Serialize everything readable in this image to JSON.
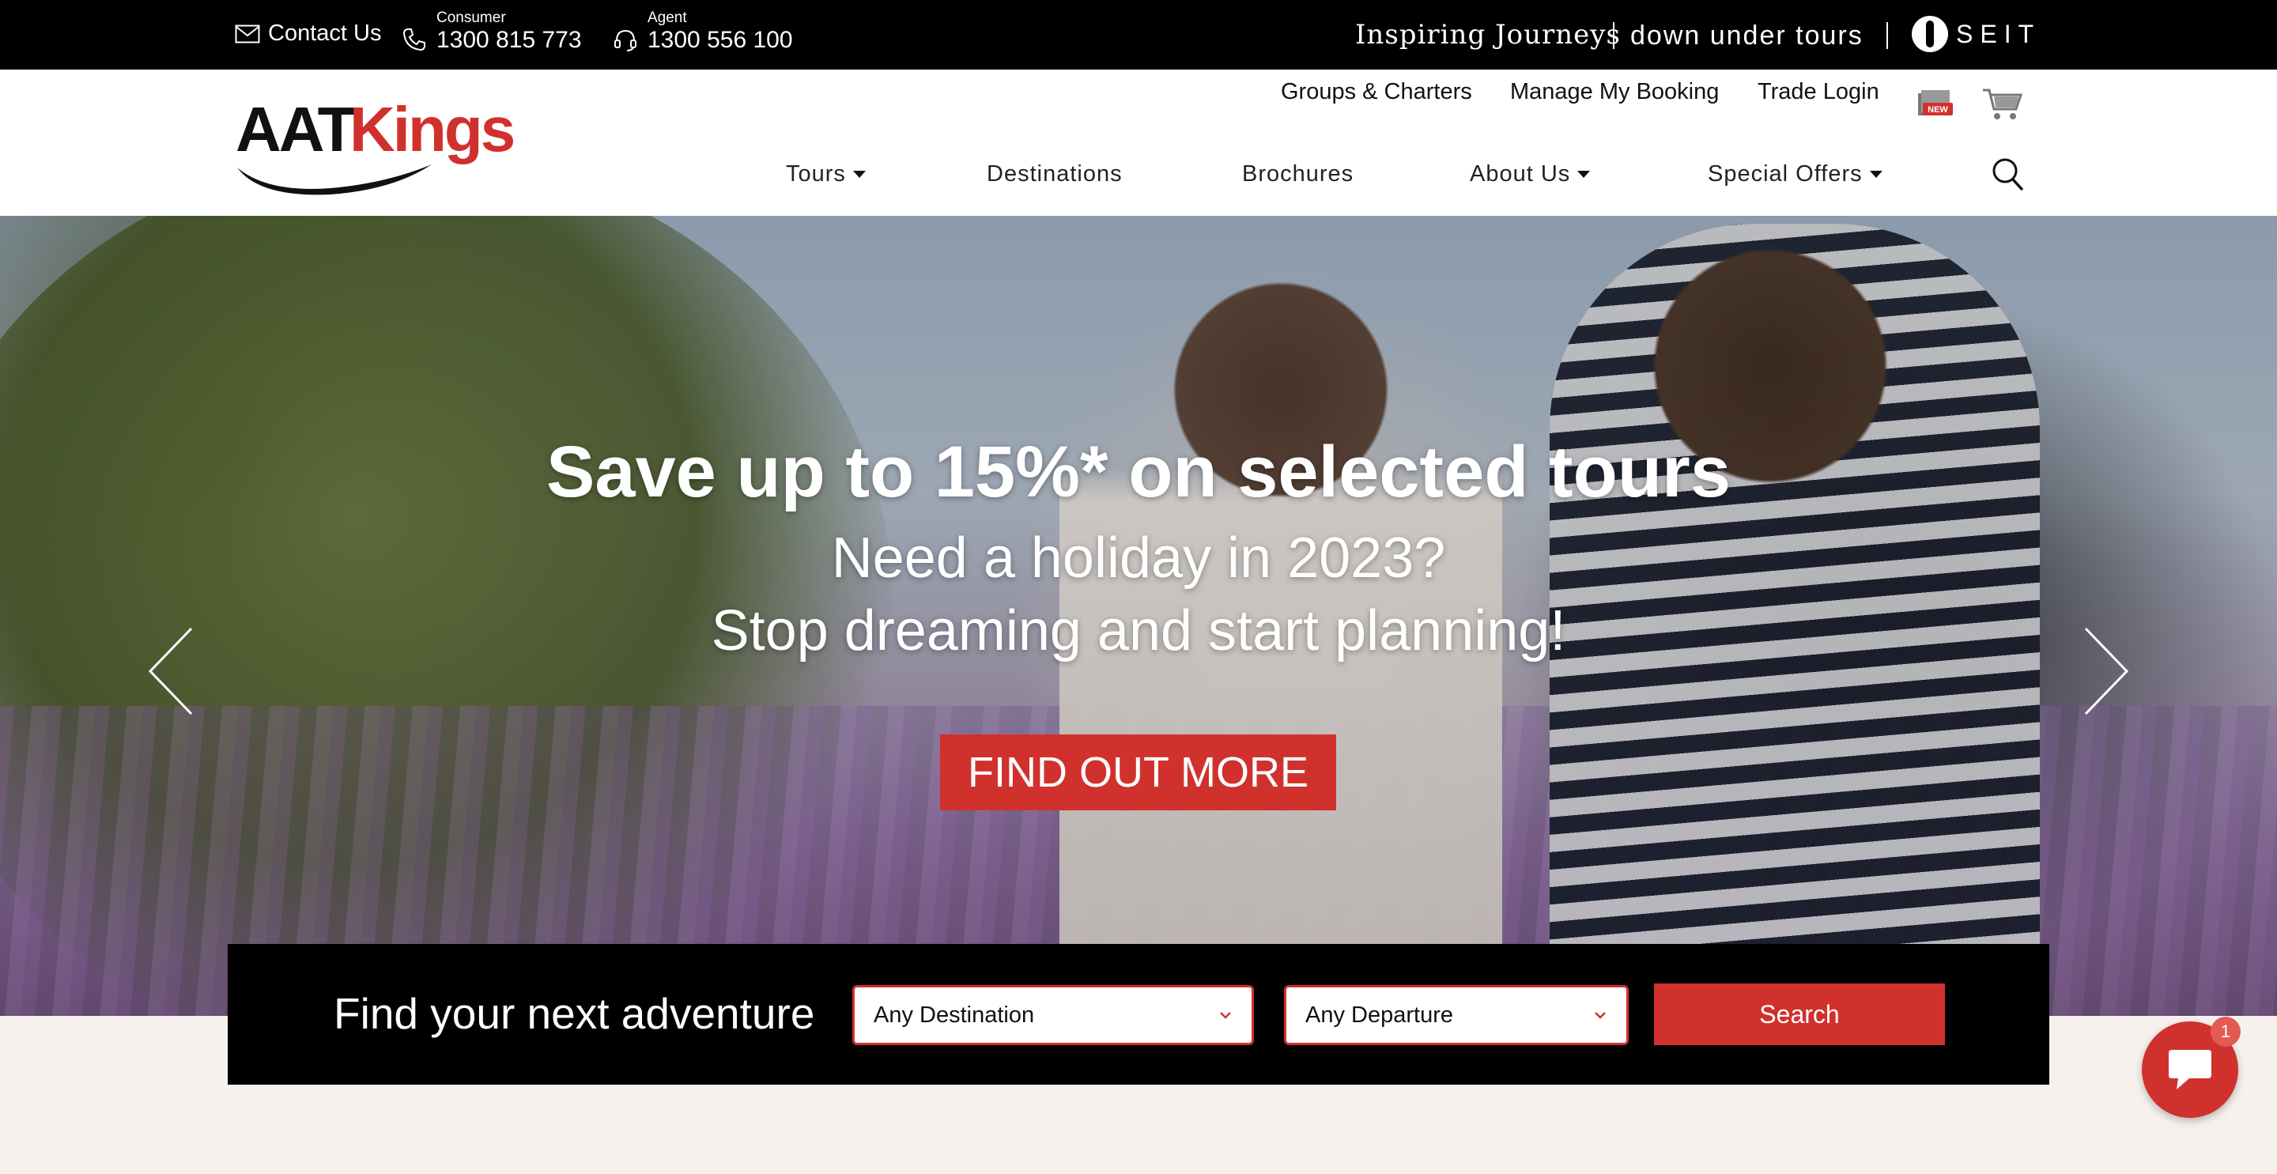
{
  "topbar": {
    "contact_label": "Contact Us",
    "consumer_label": "Consumer",
    "consumer_number": "1300 815 773",
    "agent_label": "Agent",
    "agent_number": "1300 556 100",
    "inspiring_journeys": "Inspiring Journeys",
    "down_under_tours": "down under tours",
    "seit": "SEIT"
  },
  "header": {
    "logo_part1": "AAT",
    "logo_part2": "Kings",
    "utility_nav": {
      "groups": "Groups & Charters",
      "manage": "Manage My Booking",
      "trade": "Trade Login",
      "news_badge": "NEW"
    },
    "main_nav": {
      "tours": "Tours",
      "destinations": "Destinations",
      "brochures": "Brochures",
      "about": "About Us",
      "special": "Special Offers"
    }
  },
  "hero": {
    "title": "Save up to 15%* on selected tours",
    "subtitle1": "Need a holiday in 2023?",
    "subtitle2": "Stop dreaming and start planning!",
    "cta": "FIND OUT MORE"
  },
  "finder": {
    "title": "Find your next adventure",
    "destination": "Any Destination",
    "departure": "Any Departure",
    "button": "Search"
  },
  "chat": {
    "badge": "1"
  },
  "colors": {
    "brand_red": "#d0312d",
    "topbar_bg": "#000000",
    "page_bg": "#f7f1ee"
  }
}
